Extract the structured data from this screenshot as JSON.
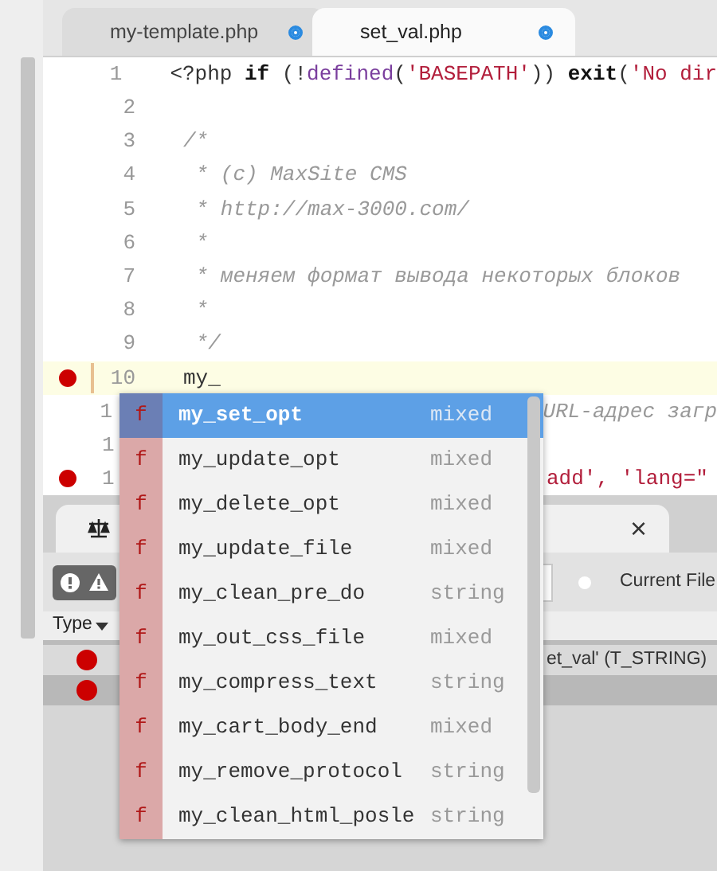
{
  "tabs": [
    {
      "label": "my-template.php",
      "selected": false
    },
    {
      "label": "set_val.php",
      "selected": true
    }
  ],
  "editor": {
    "lines": [
      {
        "number": "1",
        "error": false,
        "current": false,
        "partial": false,
        "segments": [
          {
            "kind": "plain",
            "text": "<?php "
          },
          {
            "kind": "keyword",
            "text": "if"
          },
          {
            "kind": "plain",
            "text": " (!"
          },
          {
            "kind": "builtin",
            "text": "defined"
          },
          {
            "kind": "plain",
            "text": "("
          },
          {
            "kind": "string",
            "text": "'BASEPATH'"
          },
          {
            "kind": "plain",
            "text": ")) "
          },
          {
            "kind": "keyword",
            "text": "exit"
          },
          {
            "kind": "plain",
            "text": "("
          },
          {
            "kind": "string",
            "text": "'No dir"
          }
        ]
      },
      {
        "number": "2",
        "error": false,
        "current": false,
        "partial": false
      },
      {
        "number": "3",
        "error": false,
        "current": false,
        "partial": false,
        "segments": [
          {
            "kind": "comment",
            "text": "/*"
          }
        ]
      },
      {
        "number": "4",
        "error": false,
        "current": false,
        "partial": false,
        "segments": [
          {
            "kind": "comment",
            "text": " * (c) MaxSite CMS"
          }
        ]
      },
      {
        "number": "5",
        "error": false,
        "current": false,
        "partial": false,
        "segments": [
          {
            "kind": "comment",
            "text": " * http://max-3000.com/"
          }
        ]
      },
      {
        "number": "6",
        "error": false,
        "current": false,
        "partial": false,
        "segments": [
          {
            "kind": "comment",
            "text": " *"
          }
        ]
      },
      {
        "number": "7",
        "error": false,
        "current": false,
        "partial": false,
        "segments": [
          {
            "kind": "comment",
            "text": " * меняем формат вывода некоторых блоков"
          }
        ]
      },
      {
        "number": "8",
        "error": false,
        "current": false,
        "partial": false,
        "segments": [
          {
            "kind": "comment",
            "text": " *"
          }
        ]
      },
      {
        "number": "9",
        "error": false,
        "current": false,
        "partial": false,
        "segments": [
          {
            "kind": "comment",
            "text": " */"
          }
        ]
      },
      {
        "number": "10",
        "error": true,
        "current": true,
        "partial": false,
        "segments": [
          {
            "kind": "plain",
            "text": "my_"
          }
        ]
      },
      {
        "number": "1",
        "error": false,
        "current": false,
        "partial": true,
        "segments": [
          {
            "kind": "comment",
            "text": "URL-адрес загр"
          }
        ]
      },
      {
        "number": "1",
        "error": false,
        "current": false,
        "partial": true
      },
      {
        "number": "1",
        "error": true,
        "current": false,
        "partial": true,
        "segments": [
          {
            "kind": "string",
            "text": "add', 'lang=\""
          }
        ]
      }
    ]
  },
  "problems_panel": {
    "close": "×",
    "current_file_checked": false,
    "filter_label": "Current File",
    "type_column": "Type",
    "rows": [
      {
        "kind": "error",
        "text": "et_val' (T_STRING)",
        "selected": false
      },
      {
        "kind": "error",
        "selected": true
      }
    ]
  },
  "autocomplete": [
    {
      "icon": "f",
      "name": "my_set_opt",
      "type": "mixed",
      "selected": true
    },
    {
      "icon": "f",
      "name": "my_update_opt",
      "type": "mixed",
      "selected": false
    },
    {
      "icon": "f",
      "name": "my_delete_opt",
      "type": "mixed",
      "selected": false
    },
    {
      "icon": "f",
      "name": "my_update_file",
      "type": "mixed",
      "selected": false
    },
    {
      "icon": "f",
      "name": "my_clean_pre_do",
      "type": "string",
      "selected": false
    },
    {
      "icon": "f",
      "name": "my_out_css_file",
      "type": "mixed",
      "selected": false
    },
    {
      "icon": "f",
      "name": "my_compress_text",
      "type": "string",
      "selected": false
    },
    {
      "icon": "f",
      "name": "my_cart_body_end",
      "type": "mixed",
      "selected": false
    },
    {
      "icon": "f",
      "name": "my_remove_protocol",
      "type": "string",
      "selected": false
    },
    {
      "icon": "f",
      "name": "my_clean_html_posle",
      "type": "string",
      "selected": false
    }
  ]
}
